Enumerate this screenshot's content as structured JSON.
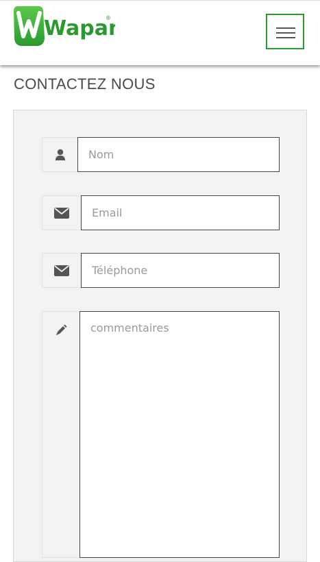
{
  "header": {
    "logo": {
      "text": "Wapano",
      "brand_color": "#2a9a2f",
      "mark": "registered-mark"
    },
    "menu_icon": "hamburger-icon",
    "menu_border_color": "#2a9a2f"
  },
  "page_title": "CONTACTEZ NOUS",
  "form": {
    "name": {
      "placeholder": "Nom",
      "value": "",
      "icon": "user-icon"
    },
    "email": {
      "placeholder": "Email",
      "value": "",
      "icon": "envelope-icon"
    },
    "phone": {
      "placeholder": "Téléphone",
      "value": "",
      "icon": "envelope-icon"
    },
    "comments": {
      "placeholder": "commentaires",
      "value": "",
      "icon": "pencil-icon"
    }
  }
}
